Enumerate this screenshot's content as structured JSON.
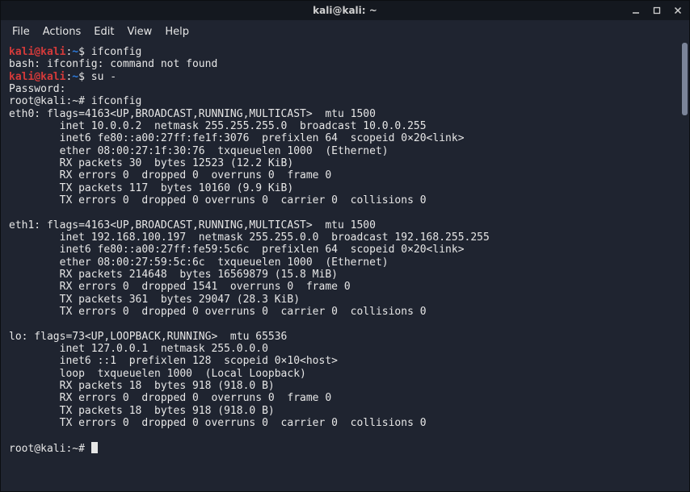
{
  "window": {
    "title": "kali@kali: ~"
  },
  "menubar": {
    "items": [
      {
        "label": "File"
      },
      {
        "label": "Actions"
      },
      {
        "label": "Edit"
      },
      {
        "label": "View"
      },
      {
        "label": "Help"
      }
    ]
  },
  "prompt1": {
    "userhost": "kali@kali",
    "sep": ":",
    "path": "~",
    "sigil": "$ ",
    "cmd": "ifconfig"
  },
  "line_bash_err": "bash: ifconfig: command not found",
  "prompt2": {
    "userhost": "kali@kali",
    "sep": ":",
    "path": "~",
    "sigil": "$ ",
    "cmd": "su -"
  },
  "line_pw": "Password:",
  "prompt3": {
    "full": "root@kali:~# ",
    "cmd": "ifconfig"
  },
  "eth0": {
    "l1": "eth0: flags=4163<UP,BROADCAST,RUNNING,MULTICAST>  mtu 1500",
    "l2": "        inet 10.0.0.2  netmask 255.255.255.0  broadcast 10.0.0.255",
    "l3": "        inet6 fe80::a00:27ff:fe1f:3076  prefixlen 64  scopeid 0×20<link>",
    "l4": "        ether 08:00:27:1f:30:76  txqueuelen 1000  (Ethernet)",
    "l5": "        RX packets 30  bytes 12523 (12.2 KiB)",
    "l6": "        RX errors 0  dropped 0  overruns 0  frame 0",
    "l7": "        TX packets 117  bytes 10160 (9.9 KiB)",
    "l8": "        TX errors 0  dropped 0 overruns 0  carrier 0  collisions 0"
  },
  "eth1": {
    "l1": "eth1: flags=4163<UP,BROADCAST,RUNNING,MULTICAST>  mtu 1500",
    "l2": "        inet 192.168.100.197  netmask 255.255.0.0  broadcast 192.168.255.255",
    "l3": "        inet6 fe80::a00:27ff:fe59:5c6c  prefixlen 64  scopeid 0×20<link>",
    "l4": "        ether 08:00:27:59:5c:6c  txqueuelen 1000  (Ethernet)",
    "l5": "        RX packets 214648  bytes 16569879 (15.8 MiB)",
    "l6": "        RX errors 0  dropped 1541  overruns 0  frame 0",
    "l7": "        TX packets 361  bytes 29047 (28.3 KiB)",
    "l8": "        TX errors 0  dropped 0 overruns 0  carrier 0  collisions 0"
  },
  "lo": {
    "l1": "lo: flags=73<UP,LOOPBACK,RUNNING>  mtu 65536",
    "l2": "        inet 127.0.0.1  netmask 255.0.0.0",
    "l3": "        inet6 ::1  prefixlen 128  scopeid 0×10<host>",
    "l4": "        loop  txqueuelen 1000  (Local Loopback)",
    "l5": "        RX packets 18  bytes 918 (918.0 B)",
    "l6": "        RX errors 0  dropped 0  overruns 0  frame 0",
    "l7": "        TX packets 18  bytes 918 (918.0 B)",
    "l8": "        TX errors 0  dropped 0 overruns 0  carrier 0  collisions 0"
  },
  "prompt4": {
    "full": "root@kali:~# "
  }
}
